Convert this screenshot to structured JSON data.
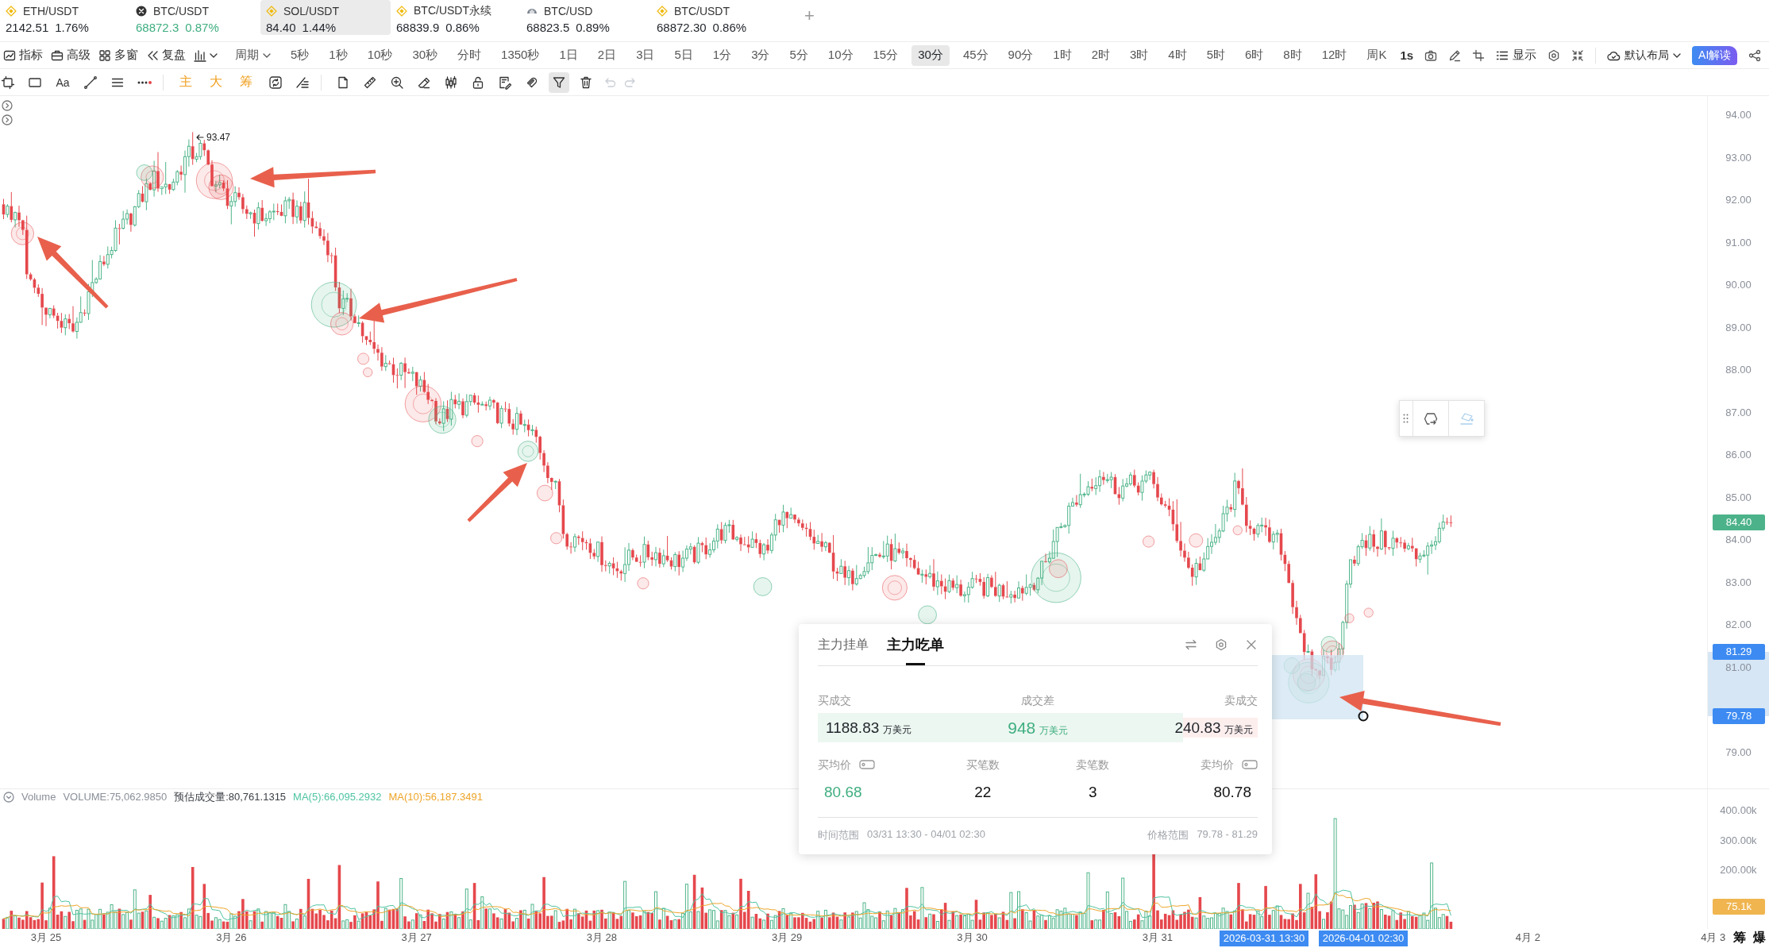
{
  "tickers": [
    {
      "pair": "ETH/USDT",
      "price": "2142.51",
      "change": "1.76%",
      "kind": "diamond",
      "color": "#1f2329",
      "selected": false
    },
    {
      "pair": "BTC/USDT",
      "price": "68872.3",
      "change": "0.87%",
      "kind": "cross",
      "color": "#3fae80",
      "selected": false
    },
    {
      "pair": "SOL/USDT",
      "price": "84.40",
      "change": "1.44%",
      "kind": "diamond",
      "color": "#1f2329",
      "selected": true
    },
    {
      "pair": "BTC/USDT永续",
      "price": "68839.9",
      "change": "0.86%",
      "kind": "diamond",
      "color": "#1f2329",
      "selected": false
    },
    {
      "pair": "BTC/USD",
      "price": "68823.5",
      "change": "0.89%",
      "kind": "arc",
      "color": "#1f2329",
      "selected": false
    },
    {
      "pair": "BTC/USDT",
      "price": "68872.30",
      "change": "0.86%",
      "kind": "diamond",
      "color": "#1f2329",
      "selected": false
    }
  ],
  "add_tab": {
    "label": "+"
  },
  "toolbar": {
    "tools": [
      {
        "label": "指标"
      },
      {
        "label": "高级"
      },
      {
        "label": "多窗"
      },
      {
        "label": "复盘"
      }
    ],
    "period": {
      "label": "周期"
    },
    "intervals": [
      {
        "label": "5秒",
        "selected": false
      },
      {
        "label": "1秒",
        "selected": false
      },
      {
        "label": "10秒",
        "selected": false
      },
      {
        "label": "30秒",
        "selected": false
      },
      {
        "label": "分时",
        "selected": false
      },
      {
        "label": "1350秒",
        "selected": false
      },
      {
        "label": "1日",
        "selected": false
      },
      {
        "label": "2日",
        "selected": false
      },
      {
        "label": "3日",
        "selected": false
      },
      {
        "label": "5日",
        "selected": false
      },
      {
        "label": "1分",
        "selected": false
      },
      {
        "label": "3分",
        "selected": false
      },
      {
        "label": "5分",
        "selected": false
      },
      {
        "label": "10分",
        "selected": false
      },
      {
        "label": "15分",
        "selected": false
      },
      {
        "label": "30分",
        "selected": true
      },
      {
        "label": "45分",
        "selected": false
      },
      {
        "label": "90分",
        "selected": false
      },
      {
        "label": "1时",
        "selected": false
      },
      {
        "label": "2时",
        "selected": false
      },
      {
        "label": "3时",
        "selected": false
      },
      {
        "label": "4时",
        "selected": false
      },
      {
        "label": "5时",
        "selected": false
      },
      {
        "label": "6时",
        "selected": false
      },
      {
        "label": "8时",
        "selected": false
      },
      {
        "label": "12时",
        "selected": false
      },
      {
        "label": "周K",
        "selected": false
      }
    ],
    "realtime": {
      "label": "1s"
    },
    "display": {
      "label": "显示"
    },
    "layout": {
      "label": "默认布局"
    },
    "ai": {
      "label": "AI解读"
    }
  },
  "drawing_toolbar": {
    "text_tool": {
      "label": "Aa"
    },
    "marks": [
      {
        "label": "主"
      },
      {
        "label": "大"
      },
      {
        "label": "筹"
      }
    ],
    "tools": [
      {
        "selected": false
      },
      {
        "selected": false
      },
      {
        "selected": false
      },
      {
        "selected": false
      },
      {
        "selected": false
      },
      {
        "selected": false
      },
      {
        "selected": false
      },
      {
        "selected": false
      },
      {
        "selected": true
      },
      {
        "selected": false
      }
    ],
    "history": [
      {
        "disabled": true
      },
      {
        "disabled": true
      }
    ]
  },
  "price_chart": {
    "high_label": "93.47",
    "ticks": [
      "94.00",
      "93.00",
      "92.00",
      "91.00",
      "90.00",
      "89.00",
      "88.00",
      "87.00",
      "86.00",
      "85.00",
      "84.00",
      "83.00",
      "82.00",
      "81.00",
      "79.00"
    ],
    "tags": [
      {
        "value": "84.40",
        "color": "#4cb28a"
      },
      {
        "value": "81.29",
        "color": "#3d8bf2"
      },
      {
        "value": "79.78",
        "color": "#3d8bf2"
      }
    ]
  },
  "floating_toolbar": {
    "tools": [
      {
        "disabled": false
      },
      {
        "disabled": true
      }
    ]
  },
  "order_panel": {
    "tabs": [
      {
        "label": "主力挂单",
        "selected": false
      },
      {
        "label": "主力吃单",
        "selected": true
      }
    ],
    "totals": [
      {
        "kind": "buy",
        "label": "买成交",
        "value": "1188.83",
        "unit": "万美元"
      },
      {
        "kind": "diff",
        "label": "成交差",
        "value": "948",
        "unit": "万美元"
      },
      {
        "kind": "sell",
        "label": "卖成交",
        "value": "240.83",
        "unit": "万美元"
      }
    ],
    "balance": {
      "level": 0.83
    },
    "stats": [
      {
        "kind": "buy_price",
        "label": "买均价",
        "value": "80.68"
      },
      {
        "kind": "count",
        "label": "买笔数",
        "value": "22"
      },
      {
        "kind": "count",
        "label": "卖笔数",
        "value": "3"
      },
      {
        "kind": "sell_price",
        "label": "卖均价",
        "value": "80.78"
      }
    ],
    "ranges": [
      {
        "label": "时间范围",
        "value": "03/31 13:30 - 04/01 02:30"
      },
      {
        "label": "价格范围",
        "value": "79.78 - 81.29"
      }
    ]
  },
  "volume": {
    "legend": [
      {
        "text": "Volume",
        "color": "#8a8f99"
      },
      {
        "text": "VOLUME:75,062.9850",
        "color": "#8a8f99"
      },
      {
        "text": "预估成交量:80,761.1315",
        "color": "#3a3f45"
      },
      {
        "text": "MA(5):66,095.2932",
        "color": "#4fc4a2"
      },
      {
        "text": "MA(10):56,187.3491",
        "color": "#eea52a"
      }
    ],
    "ticks": [
      "400.00k",
      "300.00k",
      "200.00k"
    ],
    "tag": {
      "value": "75.1k"
    }
  },
  "time_axis": {
    "labels": [
      "3月 25",
      "3月 26",
      "3月 27",
      "3月 28",
      "3月 29",
      "3月 30",
      "3月 31",
      "4月 2",
      "4月 3"
    ],
    "tags": [
      {
        "value": "2026-03-31 13:30"
      },
      {
        "value": "2026-04-01 02:30"
      }
    ]
  },
  "corner_buttons": [
    {
      "label": "筹"
    },
    {
      "label": "爆"
    }
  ]
}
